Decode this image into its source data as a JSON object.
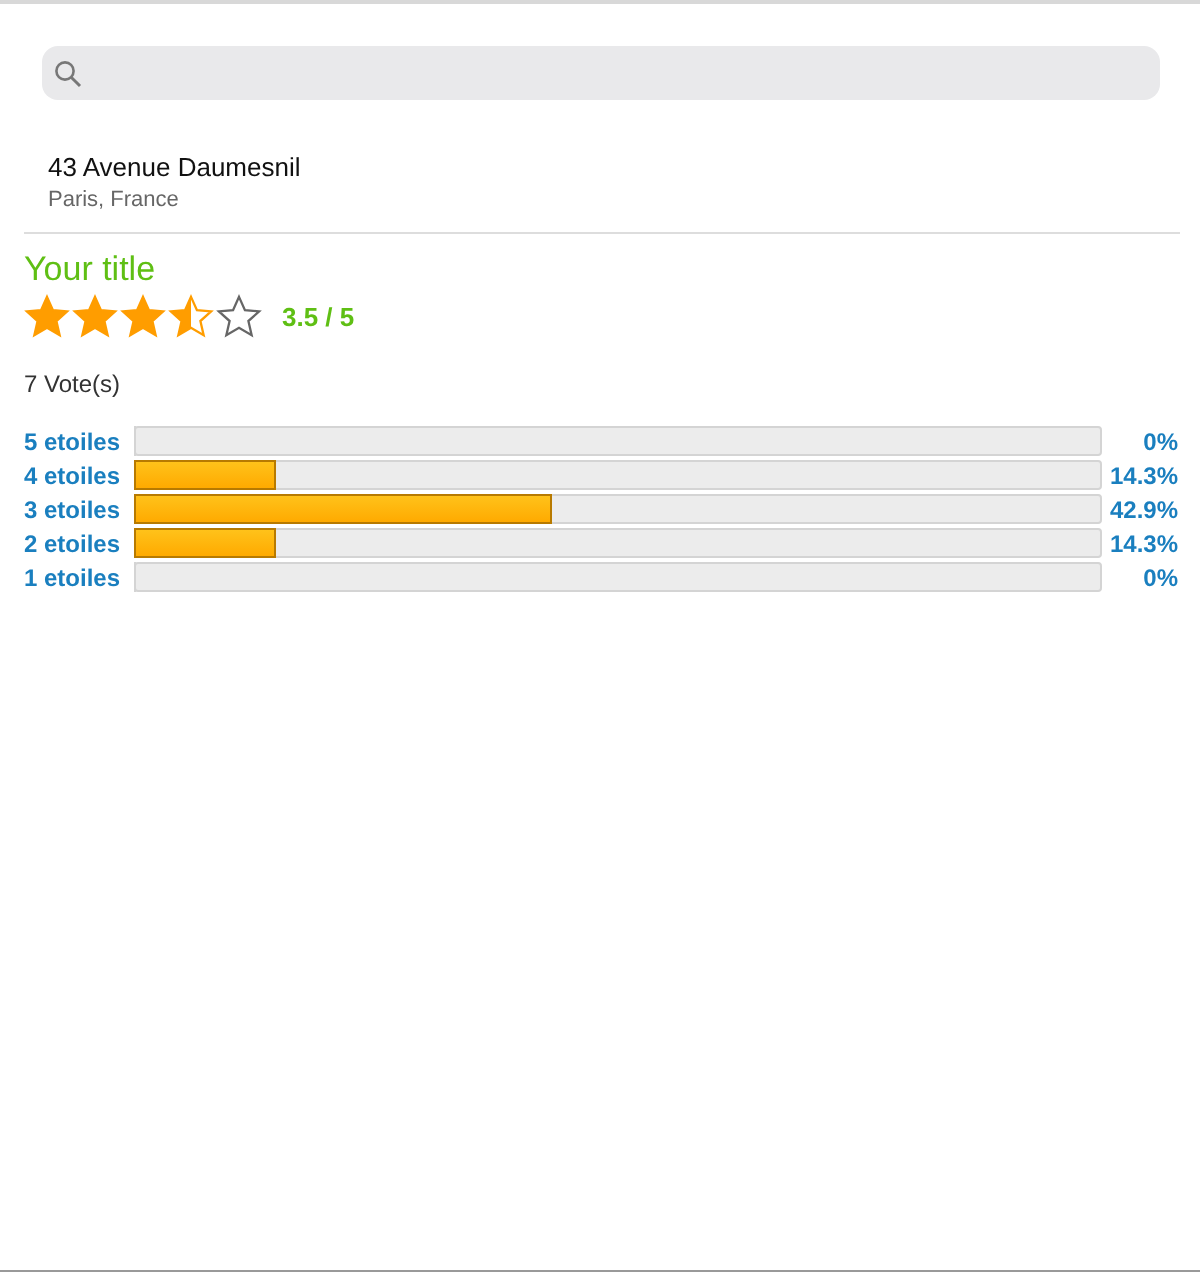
{
  "location": {
    "street": "43 Avenue Daumesnil",
    "city": "Paris, France"
  },
  "rating": {
    "title": "Your title",
    "stars": 3.5,
    "score": "3.5 / 5",
    "votes": "7 Vote(s)"
  },
  "breakdown": [
    {
      "label": "5 etoiles",
      "level": 0,
      "percent": "0%"
    },
    {
      "label": "4 etoiles",
      "level": 0.143,
      "percent": "14.3%"
    },
    {
      "label": "3 etoiles",
      "level": 0.429,
      "percent": "42.9%"
    },
    {
      "label": "2 etoiles",
      "level": 0.143,
      "percent": "14.3%"
    },
    {
      "label": "1 etoiles",
      "level": 0,
      "percent": "0%"
    }
  ]
}
